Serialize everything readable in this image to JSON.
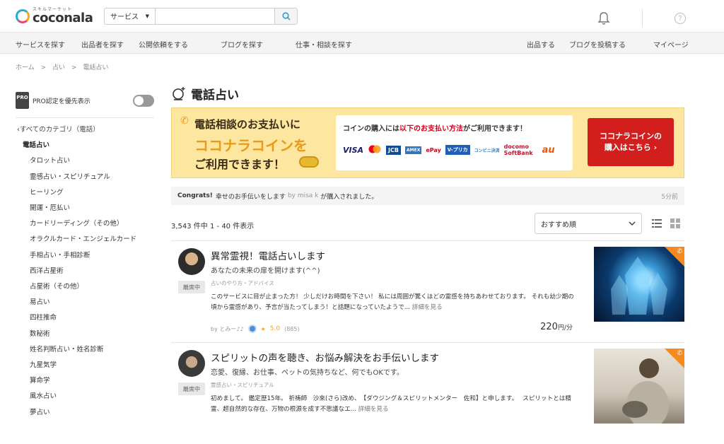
{
  "header": {
    "logo_sub": "スキルマーケット",
    "logo_main": "coconala",
    "search_category": "サービス",
    "search_placeholder": ""
  },
  "nav": {
    "items": [
      "サービスを探す",
      "出品者を探す",
      "公開依頼をする",
      "ブログを探す",
      "仕事・相談を探す",
      "出品する",
      "ブログを投稿する",
      "マイページ"
    ]
  },
  "breadcrumb": [
    "ホーム",
    ">",
    "占い",
    ">",
    "電話占い"
  ],
  "sidebar": {
    "pro_badge": "PRO",
    "pro_label": "PRO認定を優先表示",
    "all_categories": "すべてのカテゴリ（電話）",
    "current": "電話占い",
    "subcategories": [
      "タロット占い",
      "霊感占い・スピリチュアル",
      "ヒーリング",
      "開運・厄払い",
      "カードリーディング（その他）",
      "オラクルカード・エンジェルカード",
      "手相占い・手相診断",
      "西洋占星術",
      "占星術（その他）",
      "易占い",
      "四柱推命",
      "数秘術",
      "姓名判断占い・姓名診断",
      "九星気学",
      "算命学",
      "風水占い",
      "夢占い"
    ]
  },
  "main": {
    "title": "電話占い",
    "banner": {
      "line1": "電話相談のお支払いに",
      "line2": "ココナラコインを",
      "line3": "ご利用できます！",
      "pay_title_pre": "コインの購入には",
      "pay_title_red": "以下のお支払い方法",
      "pay_title_post": "がご利用できます！",
      "pay_logos": [
        "VISA",
        "MasterCard",
        "JCB",
        "AMEX",
        "ePay",
        "V-プリカ",
        "コンビニ決済",
        "docomo SoftBank",
        "au"
      ],
      "cta_line1": "ココナラコインの",
      "cta_line2": "購入はこちら ›"
    },
    "congrats": {
      "label": "Congrats!",
      "service": "幸せのお手伝いをします",
      "by": "by misa k",
      "text": "が購入されました。",
      "ago": "5分前"
    },
    "count_text": "3,543 件中 1 - 40 件表示",
    "sort": "おすすめ順",
    "cards": [
      {
        "status": "離席中",
        "title": "異常霊視！電話占いします",
        "subtitle": "あなたの未来の扉を開けます(^^)",
        "category": "占いのやり方・アドバイス",
        "desc": "このサービスに目が止まった方！ 少しだけお時間を下さい！ 私には周囲が驚くほどの霊感を持ちあわせております。 それも幼少期の頃から霊感があり、予言が当たってしまう！と話題になっていたようで...",
        "more": "詳細を見る",
        "by": "by とみー♪♪",
        "rating": "5.0",
        "reviews": "(885)",
        "price": "220",
        "unit": "円/分"
      },
      {
        "status": "離席中",
        "title": "スピリットの声を聴き、お悩み解決をお手伝いします",
        "subtitle": "恋愛、復縁、お仕事、ペットの気持ちなど、何でもOKです。",
        "category": "霊感占い・スピリチュアル",
        "desc": "初めまして。 鑑定歴15年。 祈祷師　沙來(さら)改め、　【ダウジング＆スピリットメンター　佐和】と申します。　 スピリットとは精霊、超自然的な存在、万物の根源を成す不思議なエ...",
        "more": "詳細を見る"
      }
    ]
  }
}
